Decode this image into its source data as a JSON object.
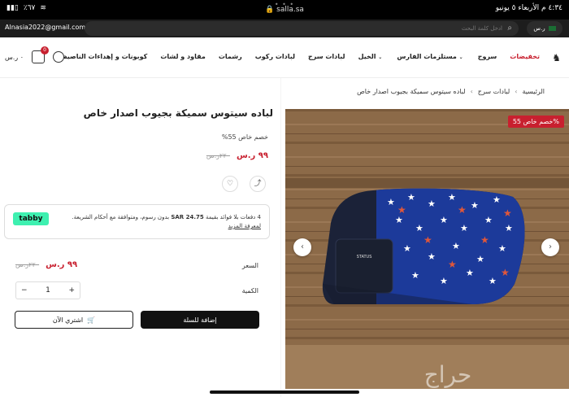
{
  "status_bar": {
    "time_date": "٤:٣٤ م  الأربعاء ٥ يونيو",
    "url": "salla.sa",
    "battery": "٪٦٧",
    "dots": "• • •"
  },
  "topbar": {
    "email": "Alnasia2022@gmail.com",
    "search_placeholder": "ادخل كلمة البحث",
    "currency": "ر.س"
  },
  "header": {
    "logo": "♞",
    "nav": [
      {
        "label": "تخفيضات",
        "active": true,
        "chevron": false
      },
      {
        "label": "سروج",
        "active": false,
        "chevron": false
      },
      {
        "label": "مستلزمات الفارس",
        "active": false,
        "chevron": true
      },
      {
        "label": "الخيل",
        "active": false,
        "chevron": true
      },
      {
        "label": "لبادات سرج",
        "active": false,
        "chevron": false
      },
      {
        "label": "لبادات ركوب",
        "active": false,
        "chevron": false
      },
      {
        "label": "رشمات",
        "active": false,
        "chevron": false
      },
      {
        "label": "مقاود و لشات",
        "active": false,
        "chevron": false
      },
      {
        "label": "كوبونات و إهداءات الناصية",
        "active": false,
        "chevron": false
      }
    ],
    "cart_total": "٠ ر.س",
    "cart_count": "0"
  },
  "breadcrumb": [
    "الرئيسية",
    "لبادات سرج",
    "لباده سيتوس سميكة بجيوب اصدار خاص"
  ],
  "product": {
    "title": "لباده سيتوس سميكة بجيوب اصدار خاص",
    "discount_text": "خصم خاص 55%",
    "badge": "خصم خاص 55%",
    "price": "٩٩ ر.س",
    "old_price": "٢٢٠ر.س",
    "image_brand_label": "STATUS",
    "watermark": "حراج"
  },
  "tabby": {
    "logo": "tabby",
    "msg_prefix": "4 دفعات بلا فوائد بقيمة",
    "amount": "SAR 24.75",
    "msg_suffix": "بدون رسوم، ومتوافقة مع أحكام الشريعة.",
    "link": "لمعرفة المزيد"
  },
  "purchase": {
    "price_label": "السعر",
    "price": "٩٩ ر.س",
    "old_price": "٢٢٠ر.س",
    "qty_label": "الكمية",
    "qty": "1",
    "add_to_cart": "إضافة للسلة",
    "buy_now": "اشتري الآن"
  }
}
